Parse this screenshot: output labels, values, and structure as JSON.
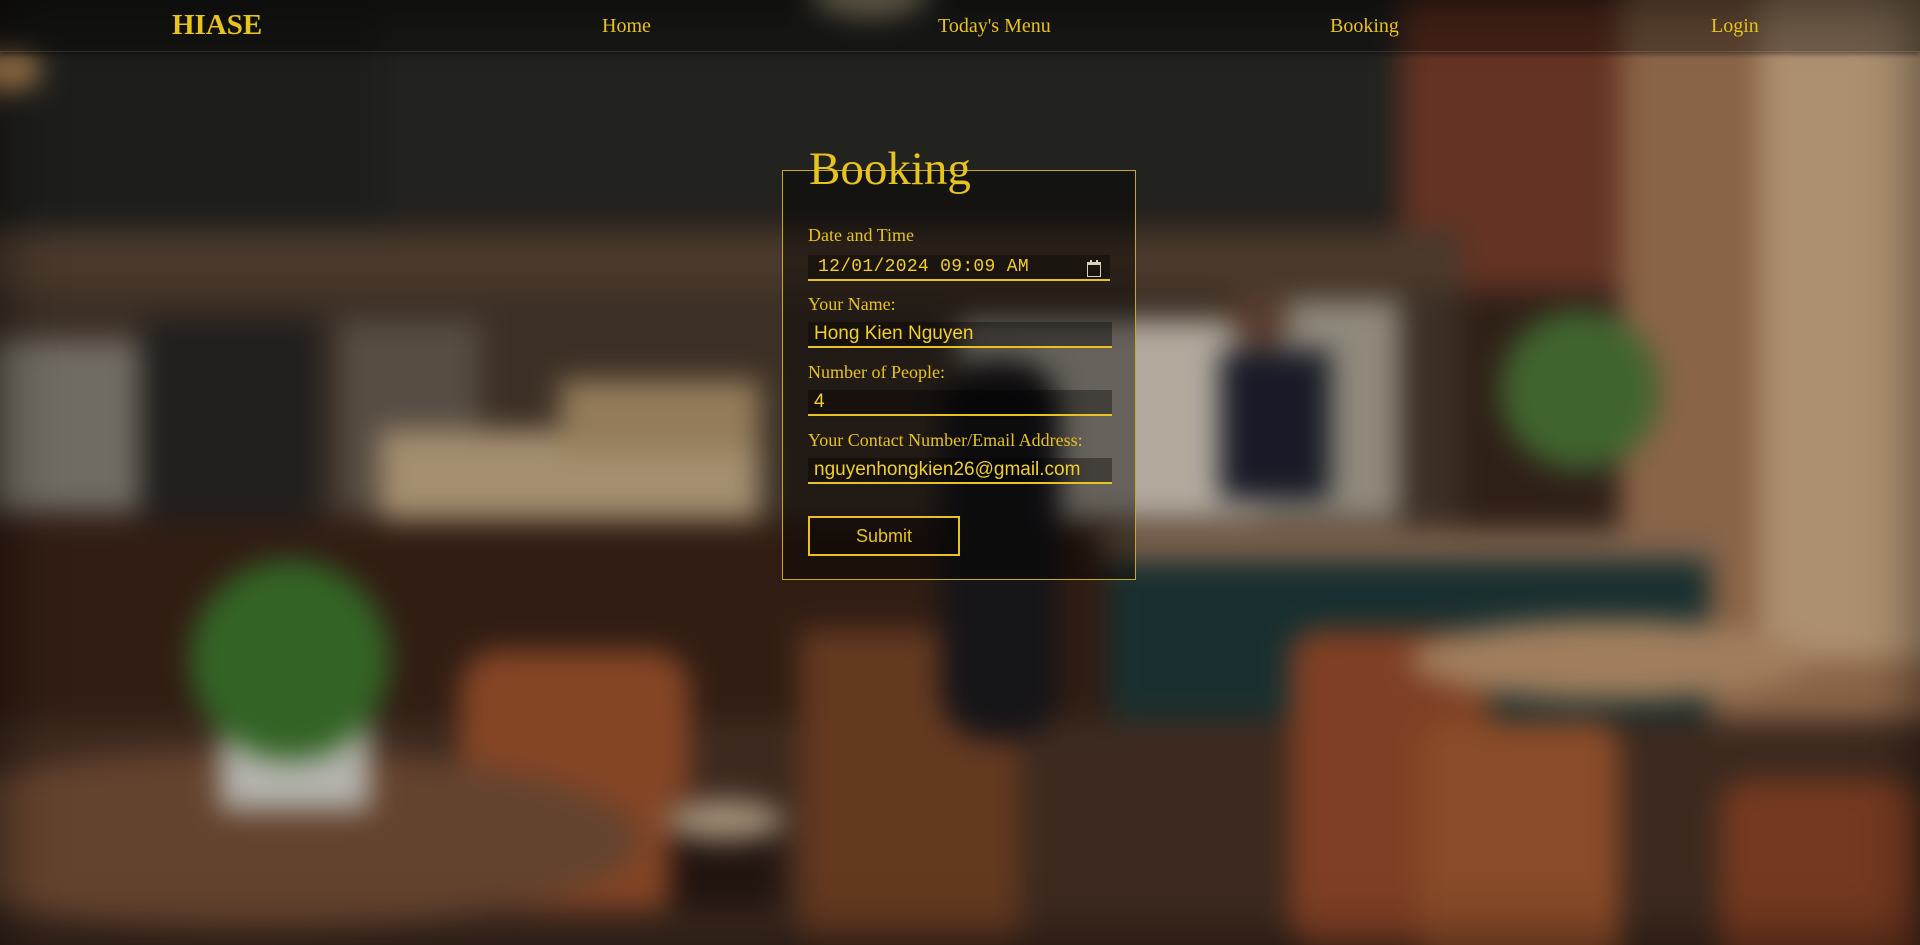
{
  "nav": {
    "brand": "HIASE",
    "home": "Home",
    "menu": "Today's Menu",
    "booking": "Booking",
    "login": "Login"
  },
  "form": {
    "title": "Booking",
    "datetime": {
      "label": "Date and Time",
      "value": "12/01/2024 09:09 AM"
    },
    "name": {
      "label": "Your Name:",
      "value": "Hong Kien Nguyen"
    },
    "people": {
      "label": "Number of People:",
      "value": "4"
    },
    "contact": {
      "label": "Your Contact Number/Email Address:",
      "value": "nguyenhongkien26@gmail.com"
    },
    "submit_label": "Submit"
  },
  "colors": {
    "accent": "#e8c21d",
    "nav_background": "rgba(0,0,0,0.35)",
    "form_background": "rgba(0,0,0,0.42)"
  },
  "icons": {
    "date_picker": "calendar-icon"
  }
}
